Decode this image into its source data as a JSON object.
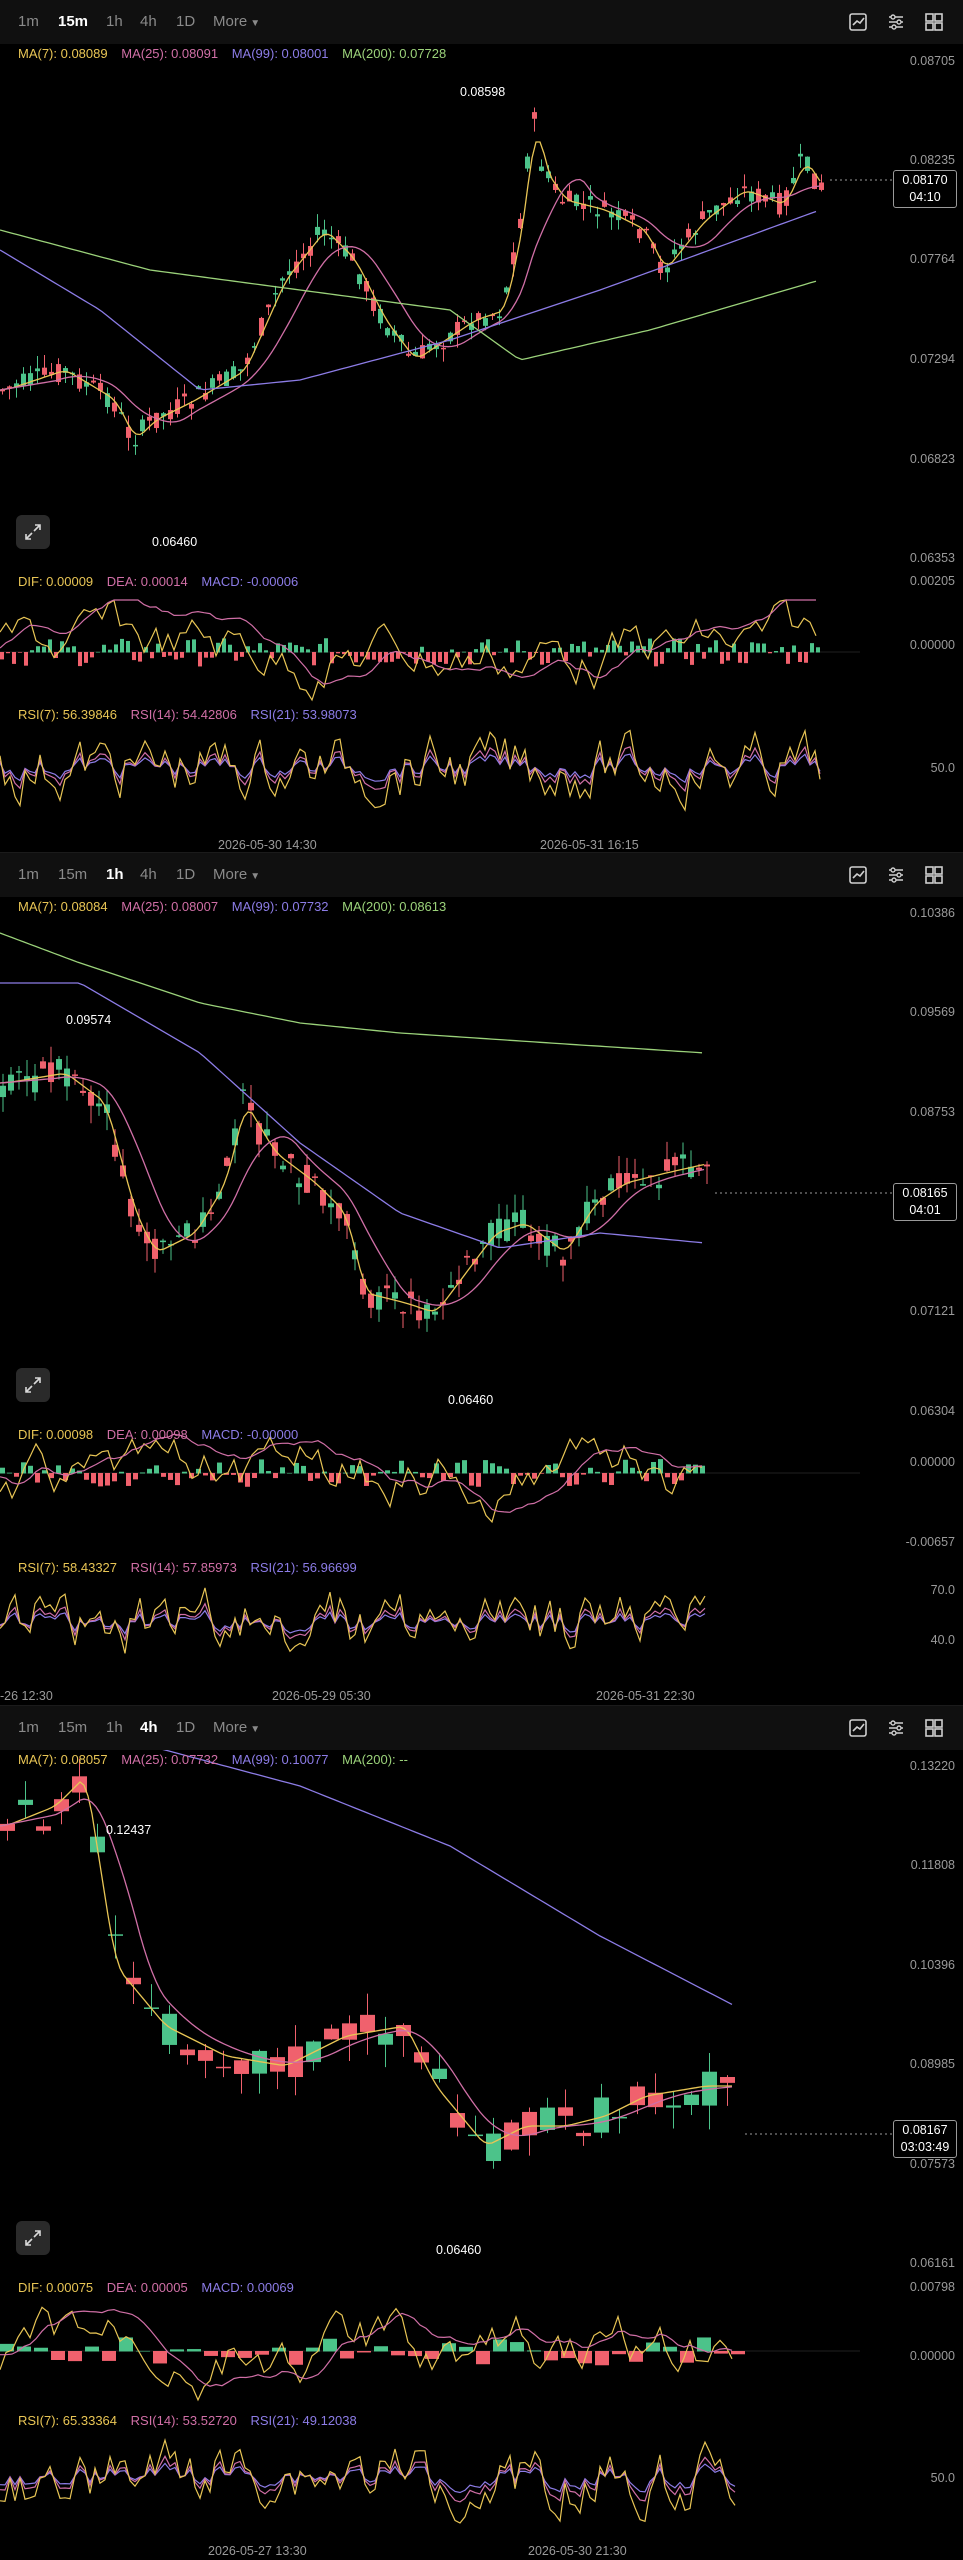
{
  "timeframes": [
    "1m",
    "15m",
    "1h",
    "4h",
    "1D"
  ],
  "more_label": "More",
  "colors": {
    "background": "#000000",
    "up": "#4cc38a",
    "down": "#f0616d",
    "ma7": "#e8c555",
    "ma25": "#d06fa6",
    "ma99": "#8c7ce6",
    "ma200": "#9bd27a"
  },
  "toolbar_icons": [
    "chart-settings-icon",
    "indicator-settings-icon",
    "grid-layout-icon"
  ],
  "panels": [
    {
      "active_tab": "15m",
      "ma": {
        "ma7": "MA(7): 0.08089",
        "ma25": "MA(25): 0.08091",
        "ma99": "MA(99): 0.08001",
        "ma200": "MA(200): 0.07728"
      },
      "price_axis": [
        "0.08705",
        "0.08235",
        "0.07764",
        "0.07294",
        "0.06823",
        "0.06353"
      ],
      "current_price": "0.08170",
      "countdown": "04:10",
      "high_label": "0.08598",
      "low_label": "0.06460",
      "macd": {
        "dif": "DIF: 0.00009",
        "dea": "DEA: 0.00014",
        "macd": "MACD: -0.00006"
      },
      "macd_axis": [
        "0.00205",
        "0.00000"
      ],
      "rsi": {
        "rsi7": "RSI(7): 56.39846",
        "rsi14": "RSI(14): 54.42806",
        "rsi21": "RSI(21): 53.98073"
      },
      "rsi_axis": [
        "50.0"
      ],
      "dates": [
        "2026-05-30 14:30",
        "2026-05-31 16:15"
      ]
    },
    {
      "active_tab": "1h",
      "ma": {
        "ma7": "MA(7): 0.08084",
        "ma25": "MA(25): 0.08007",
        "ma99": "MA(99): 0.07732",
        "ma200": "MA(200): 0.08613"
      },
      "price_axis": [
        "0.10386",
        "0.09569",
        "0.08753",
        "0.07121",
        "0.06304"
      ],
      "current_price": "0.08165",
      "countdown": "04:01",
      "high_label": "0.09574",
      "low_label": "0.06460",
      "macd": {
        "dif": "DIF: 0.00098",
        "dea": "DEA: 0.00098",
        "macd": "MACD: -0.00000"
      },
      "macd_axis": [
        "0.00000",
        "-0.00657"
      ],
      "rsi": {
        "rsi7": "RSI(7): 58.43327",
        "rsi14": "RSI(14): 57.85973",
        "rsi21": "RSI(21): 56.96699"
      },
      "rsi_axis": [
        "70.0",
        "40.0"
      ],
      "dates": [
        "-26 12:30",
        "2026-05-29 05:30",
        "2026-05-31 22:30"
      ]
    },
    {
      "active_tab": "4h",
      "ma": {
        "ma7": "MA(7): 0.08057",
        "ma25": "MA(25): 0.07732",
        "ma99": "MA(99): 0.10077",
        "ma200": "MA(200): --"
      },
      "price_axis": [
        "0.13220",
        "0.11808",
        "0.10396",
        "0.08985",
        "0.07573",
        "0.06161"
      ],
      "current_price": "0.08167",
      "countdown": "03:03:49",
      "high_label": "0.12437",
      "low_label": "0.06460",
      "macd": {
        "dif": "DIF: 0.00075",
        "dea": "DEA: 0.00005",
        "macd": "MACD: 0.00069"
      },
      "macd_axis": [
        "0.00798",
        "0.00000"
      ],
      "rsi": {
        "rsi7": "RSI(7): 65.33364",
        "rsi14": "RSI(14): 53.52720",
        "rsi21": "RSI(21): 49.12038"
      },
      "rsi_axis": [
        "50.0"
      ],
      "dates": [
        "2026-05-27 13:30",
        "2026-05-30 21:30"
      ]
    }
  ]
}
